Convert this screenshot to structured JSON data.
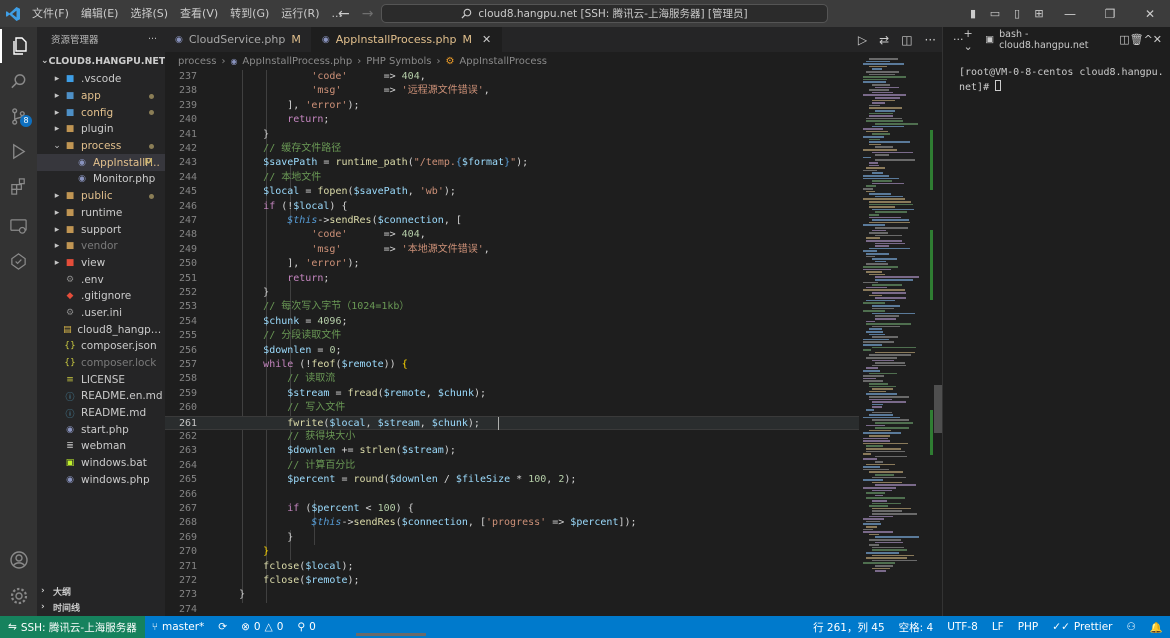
{
  "titlebar": {
    "menu": [
      "文件(F)",
      "编辑(E)",
      "选择(S)",
      "查看(V)",
      "转到(G)",
      "运行(R)",
      "..."
    ],
    "search_text": "cloud8.hangpu.net [SSH: 腾讯云-上海服务器] [管理员]"
  },
  "sidebar": {
    "title": "资源管理器",
    "root": "CLOUD8.HANGPU.NET [SS...",
    "items": [
      {
        "label": ".vscode",
        "type": "folder",
        "icon": "vscode-folder-icon"
      },
      {
        "label": "app",
        "type": "folder",
        "mod": "dot"
      },
      {
        "label": "config",
        "type": "folder",
        "mod": "dot"
      },
      {
        "label": "plugin",
        "type": "folder"
      },
      {
        "label": "process",
        "type": "folder-open",
        "mod": "dot"
      },
      {
        "label": "AppInstallP...",
        "type": "php",
        "mod": "M",
        "selected": true
      },
      {
        "label": "Monitor.php",
        "type": "php"
      },
      {
        "label": "public",
        "type": "folder",
        "mod": "dot"
      },
      {
        "label": "runtime",
        "type": "folder"
      },
      {
        "label": "support",
        "type": "folder"
      },
      {
        "label": "vendor",
        "type": "folder",
        "dim": true
      },
      {
        "label": "view",
        "type": "folder"
      },
      {
        "label": ".env",
        "type": "gear"
      },
      {
        "label": ".gitignore",
        "type": "git"
      },
      {
        "label": ".user.ini",
        "type": "gear"
      },
      {
        "label": "cloud8_hangpu_n...",
        "type": "db"
      },
      {
        "label": "composer.json",
        "type": "json"
      },
      {
        "label": "composer.lock",
        "type": "json",
        "dim": true
      },
      {
        "label": "LICENSE",
        "type": "license"
      },
      {
        "label": "README.en.md",
        "type": "md"
      },
      {
        "label": "README.md",
        "type": "md"
      },
      {
        "label": "start.php",
        "type": "php"
      },
      {
        "label": "webman",
        "type": "file"
      },
      {
        "label": "windows.bat",
        "type": "bat"
      },
      {
        "label": "windows.php",
        "type": "php"
      }
    ],
    "outline": "大纲",
    "timeline": "时间线"
  },
  "tabs": [
    {
      "label": "CloudService.php",
      "mod": "M",
      "active": false
    },
    {
      "label": "AppInstallProcess.php",
      "mod": "M",
      "active": true
    }
  ],
  "breadcrumb": [
    "process",
    "AppInstallProcess.php",
    "PHP Symbols",
    "AppInstallProcess"
  ],
  "editor": {
    "current_line": 261,
    "lines": [
      {
        "n": 237,
        "html": "                <span class=\"s\">'code'</span>      <span class=\"op\">=></span> <span class=\"n\">404</span>,"
      },
      {
        "n": 238,
        "html": "                <span class=\"s\">'msg'</span>       <span class=\"op\">=></span> <span class=\"s\">'远程源文件错误'</span>,"
      },
      {
        "n": 239,
        "html": "            ], <span class=\"s\">'error'</span>);"
      },
      {
        "n": 240,
        "html": "            <span class=\"k\">return</span>;"
      },
      {
        "n": 241,
        "html": "        }"
      },
      {
        "n": 242,
        "html": "        <span class=\"cm\">// 缓存文件路径</span>"
      },
      {
        "n": 243,
        "html": "        <span class=\"v\">$savePath</span> <span class=\"op\">=</span> <span class=\"f\">runtime_path</span>(<span class=\"s\">\"/temp.</span><span class=\"lit\">{</span><span class=\"v\">$format</span><span class=\"lit\">}</span><span class=\"s\">\"</span>);"
      },
      {
        "n": 244,
        "html": "        <span class=\"cm\">// 本地文件</span>"
      },
      {
        "n": 245,
        "html": "        <span class=\"v\">$local</span> <span class=\"op\">=</span> <span class=\"f\">fopen</span>(<span class=\"v\">$savePath</span>, <span class=\"s\">'wb'</span>);"
      },
      {
        "n": 246,
        "html": "        <span class=\"k\">if</span> (<span class=\"op\">!</span><span class=\"v\">$local</span>) {"
      },
      {
        "n": 247,
        "html": "            <span class=\"th\">$this</span><span class=\"op\">-></span><span class=\"f\">sendRes</span>(<span class=\"v\">$connection</span>, ["
      },
      {
        "n": 248,
        "html": "                <span class=\"s\">'code'</span>      <span class=\"op\">=></span> <span class=\"n\">404</span>,"
      },
      {
        "n": 249,
        "html": "                <span class=\"s\">'msg'</span>       <span class=\"op\">=></span> <span class=\"s\">'本地源文件错误'</span>,"
      },
      {
        "n": 250,
        "html": "            ], <span class=\"s\">'error'</span>);"
      },
      {
        "n": 251,
        "html": "            <span class=\"k\">return</span>;"
      },
      {
        "n": 252,
        "html": "        }"
      },
      {
        "n": 253,
        "html": "        <span class=\"cm\">// 每次写入字节（1024=1kb）</span>"
      },
      {
        "n": 254,
        "html": "        <span class=\"v\">$chunk</span> <span class=\"op\">=</span> <span class=\"n\">4096</span>;"
      },
      {
        "n": 255,
        "html": "        <span class=\"cm\">// 分段读取文件</span>"
      },
      {
        "n": 256,
        "html": "        <span class=\"v\">$downlen</span> <span class=\"op\">=</span> <span class=\"n\">0</span>;"
      },
      {
        "n": 257,
        "html": "        <span class=\"k\">while</span> (<span class=\"op\">!</span><span class=\"f\">feof</span>(<span class=\"v\">$remote</span>)) <span class=\"p\">{</span>"
      },
      {
        "n": 258,
        "html": "            <span class=\"cm\">// 读取流</span>"
      },
      {
        "n": 259,
        "html": "            <span class=\"v\">$stream</span> <span class=\"op\">=</span> <span class=\"f\">fread</span>(<span class=\"v\">$remote</span>, <span class=\"v\">$chunk</span>);"
      },
      {
        "n": 260,
        "html": "            <span class=\"cm\">// 写入文件</span>"
      },
      {
        "n": 261,
        "html": "            <span class=\"f\">fwrite</span>(<span class=\"v\">$local</span>, <span class=\"v\">$stream</span>, <span class=\"v\">$chunk</span>);"
      },
      {
        "n": 262,
        "html": "            <span class=\"cm\">// 获得块大小</span>"
      },
      {
        "n": 263,
        "html": "            <span class=\"v\">$downlen</span> <span class=\"op\">+=</span> <span class=\"f\">strlen</span>(<span class=\"v\">$stream</span>);"
      },
      {
        "n": 264,
        "html": "            <span class=\"cm\">// 计算百分比</span>"
      },
      {
        "n": 265,
        "html": "            <span class=\"v\">$percent</span> <span class=\"op\">=</span> <span class=\"f\">round</span>(<span class=\"v\">$downlen</span> <span class=\"op\">/</span> <span class=\"v\">$fileSize</span> <span class=\"op\">*</span> <span class=\"n\">100</span>, <span class=\"n\">2</span>);"
      },
      {
        "n": 266,
        "html": ""
      },
      {
        "n": 267,
        "html": "            <span class=\"k\">if</span> (<span class=\"v\">$percent</span> <span class=\"op\">&lt;</span> <span class=\"n\">100</span>) {"
      },
      {
        "n": 268,
        "html": "                <span class=\"th\">$this</span><span class=\"op\">-></span><span class=\"f\">sendRes</span>(<span class=\"v\">$connection</span>, [<span class=\"s\">'progress'</span> <span class=\"op\">=></span> <span class=\"v\">$percent</span>]);"
      },
      {
        "n": 269,
        "html": "            }"
      },
      {
        "n": 270,
        "html": "        <span class=\"p\">}</span>"
      },
      {
        "n": 271,
        "html": "        <span class=\"f\">fclose</span>(<span class=\"v\">$local</span>);"
      },
      {
        "n": 272,
        "html": "        <span class=\"f\">fclose</span>(<span class=\"v\">$remote</span>);"
      },
      {
        "n": 273,
        "html": "    }"
      },
      {
        "n": 274,
        "html": ""
      }
    ]
  },
  "terminal": {
    "name": "bash - cloud8.hangpu.net",
    "prompt_line1": "[root@VM-0-8-centos cloud8.hangpu.",
    "prompt_line2": "net]# "
  },
  "statusbar": {
    "remote": "SSH: 腾讯云-上海服务器",
    "branch": "master*",
    "errors": "0",
    "warnings": "0",
    "ports": "0",
    "position": "行 261，列 45",
    "spaces": "空格: 4",
    "encoding": "UTF-8",
    "eol": "LF",
    "language": "PHP",
    "formatter": "Prettier"
  },
  "colors": {
    "accent": "#007acc",
    "remote": "#16825d",
    "modified": "#e2c08d"
  }
}
